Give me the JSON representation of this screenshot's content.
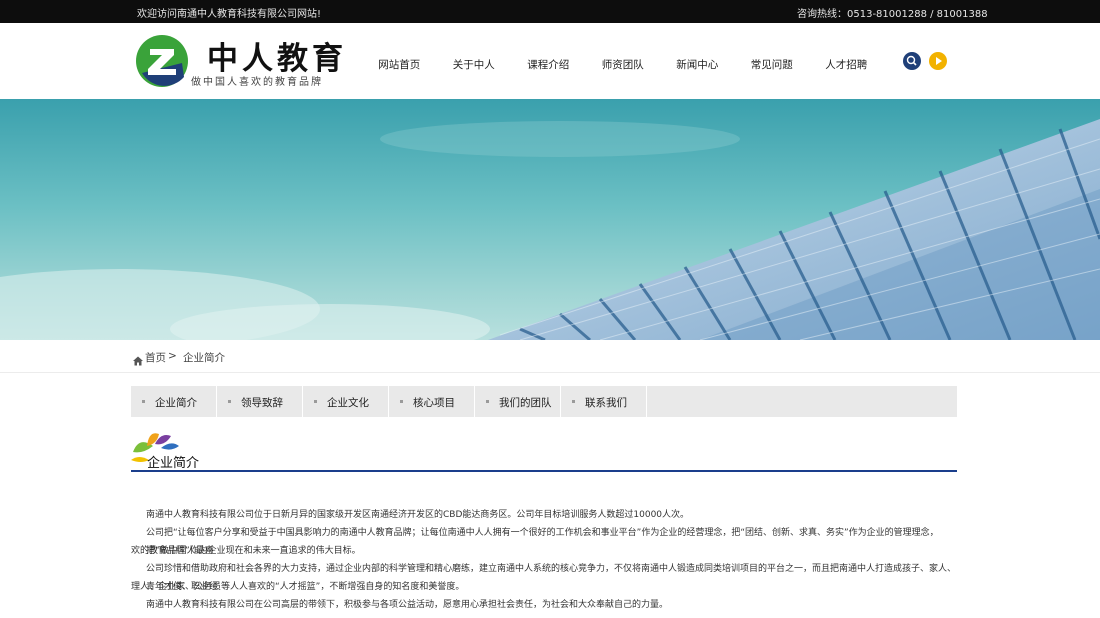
{
  "topbar": {
    "welcome": "欢迎访问南通中人教育科技有限公司网站!",
    "hotline": "咨询热线：0513-81001288 / 81001388"
  },
  "header": {
    "brand_name": "中人教育",
    "slogan": "做中国人喜欢的教育品牌",
    "nav": [
      "网站首页",
      "关于中人",
      "课程介绍",
      "师资团队",
      "新闻中心",
      "常见问题",
      "人才招聘"
    ],
    "icons": [
      "search-icon",
      "play-icon"
    ]
  },
  "breadcrumb": {
    "home": "首页",
    "separator": ">",
    "current": "企业简介"
  },
  "tabs": [
    "企业简介",
    "领导致辞",
    "企业文化",
    "核心项目",
    "我们的团队",
    "联系我们"
  ],
  "section": {
    "title": "企业简介"
  },
  "content": {
    "p1": "南通中人教育科技有限公司位于日新月异的国家级开发区南通经济开发区的CBD能达商务区。公司年目标培训服务人数超过10000人次。",
    "p2a": "公司把“让每位客户分享和受益于中国具影响力的南通中人教育品牌；让每位南通中人人拥有一个很好的工作机会和事业平台”作为企业的经营理念，把“团结、创新、求真、务实”作为企业的管理理念，把“做中国人最喜",
    "p2b": "欢的教育品牌”作为企业现在和未来一直追求的伟大目标。",
    "p3a": "公司珍惜和借助政府和社会各界的大力支持，通过企业内部的科学管理和精心磨练，建立南通中人系统的核心竞争力，不仅将南通中人锻造成同类培训项目的平台之一，而且把南通中人打造成孩子、家人、青年才俊、职业经",
    "p3b": "理人、企业家、公务员等人人喜欢的“人才摇篮”，不断增强自身的知名度和美誉度。",
    "p4": "南通中人教育科技有限公司在公司高层的带领下，积极参与各项公益活动，愿意用心承担社会责任，为社会和大众奉献自己的力量。"
  },
  "colors": {
    "topbar_bg": "#0d0d0d",
    "accent_blue": "#1a3e8c",
    "logo_green": "#3aa33a",
    "play_yellow": "#f2b200",
    "tab_bg": "#e9e9e9"
  }
}
